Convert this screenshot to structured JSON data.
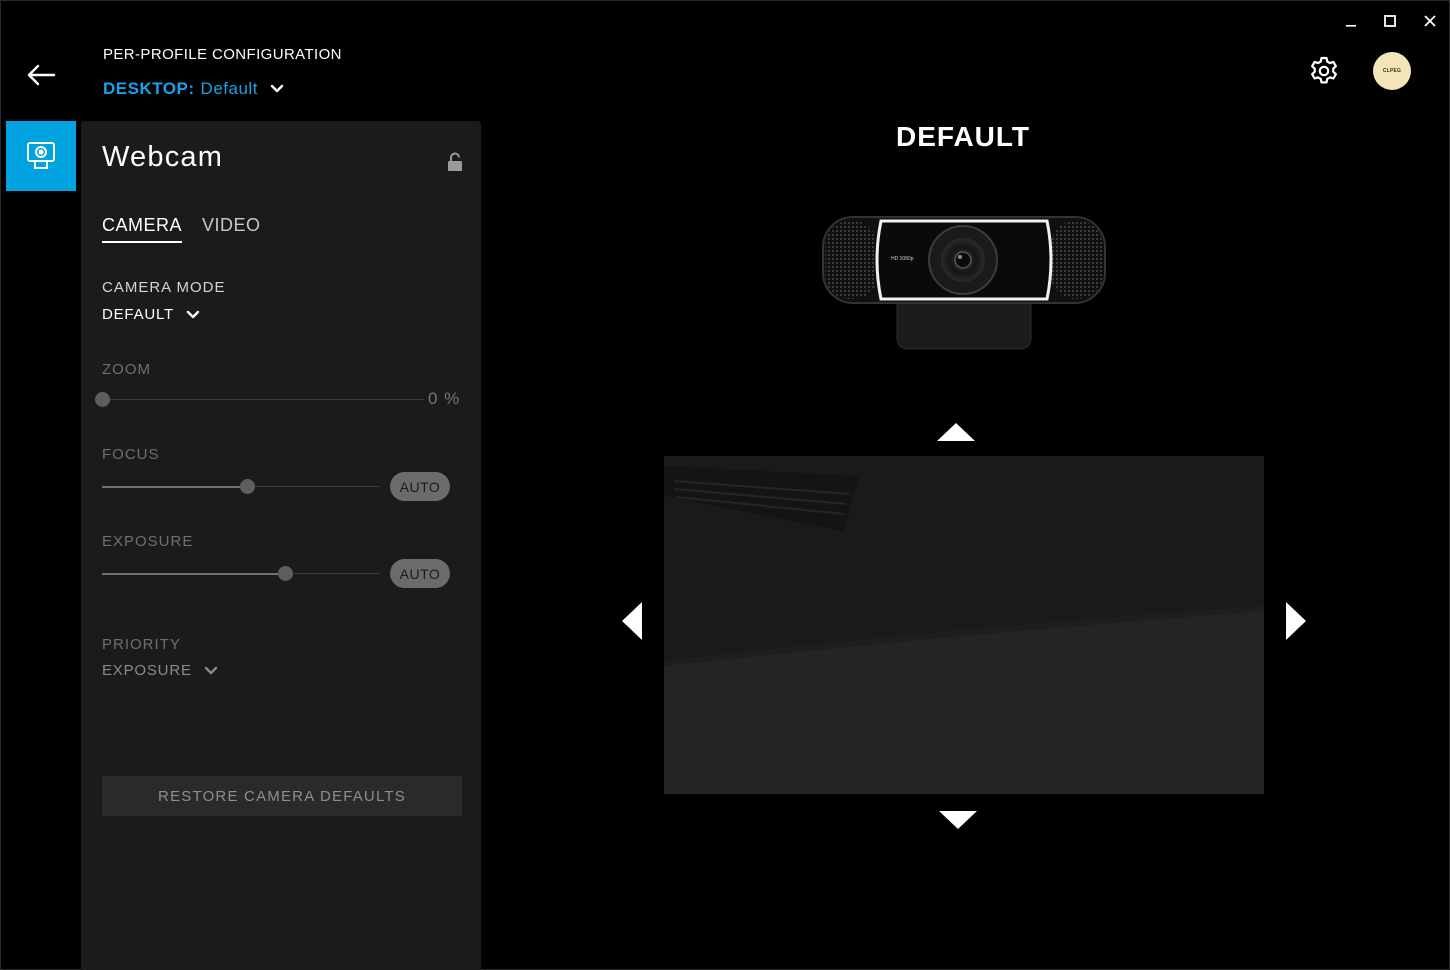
{
  "window": {
    "controls": [
      "minimize",
      "maximize",
      "close"
    ]
  },
  "header": {
    "subtitle": "PER-PROFILE CONFIGURATION",
    "profile_prefix": "DESKTOP:",
    "profile_name": "Default",
    "avatar_text": "CLPEG"
  },
  "panel": {
    "title": "Webcam",
    "tabs": [
      {
        "label": "CAMERA",
        "active": true
      },
      {
        "label": "VIDEO",
        "active": false
      }
    ],
    "camera_mode": {
      "label": "CAMERA MODE",
      "value": "DEFAULT"
    },
    "zoom": {
      "label": "ZOOM",
      "value": 0,
      "readout": "0 %"
    },
    "focus": {
      "label": "FOCUS",
      "level": 0.52,
      "auto_label": "AUTO"
    },
    "exposure": {
      "label": "EXPOSURE",
      "level": 0.66,
      "auto_label": "AUTO"
    },
    "priority": {
      "label": "PRIORITY",
      "value": "EXPOSURE"
    },
    "restore_label": "RESTORE CAMERA DEFAULTS"
  },
  "preview": {
    "title": "DEFAULT",
    "webcam_badge": "HD 1080p"
  },
  "colors": {
    "accent": "#17a2e8",
    "tab_active_bg": "#00a2e0",
    "panel_bg": "#1b1b1b",
    "app_bg": "#000000",
    "avatar_bg": "#f2e6b8"
  },
  "icons": {
    "back": "arrow-left-icon",
    "settings": "gear-icon",
    "device": "webcam-icon",
    "lock": "unlock-icon",
    "chevron": "chevron-down-icon"
  }
}
